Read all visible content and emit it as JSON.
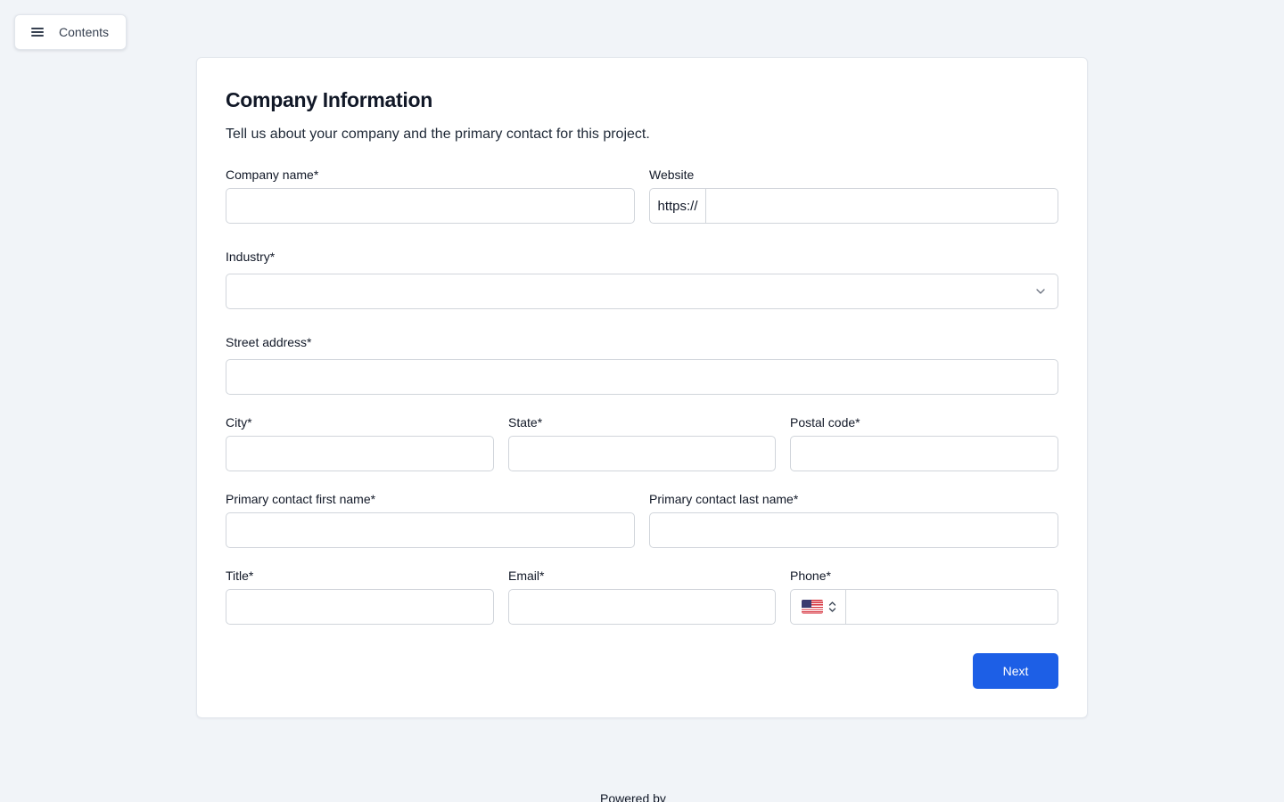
{
  "nav": {
    "contents_label": "Contents"
  },
  "form": {
    "title": "Company Information",
    "subtitle": "Tell us about your company and the primary contact for this project.",
    "fields": {
      "company_name": {
        "label": "Company name*",
        "value": ""
      },
      "website": {
        "label": "Website",
        "prefix": "https://",
        "value": ""
      },
      "industry": {
        "label": "Industry*",
        "value": ""
      },
      "street_address": {
        "label": "Street address*",
        "value": ""
      },
      "city": {
        "label": "City*",
        "value": ""
      },
      "state": {
        "label": "State*",
        "value": ""
      },
      "postal_code": {
        "label": "Postal code*",
        "value": ""
      },
      "first_name": {
        "label": "Primary contact first name*",
        "value": ""
      },
      "last_name": {
        "label": "Primary contact last name*",
        "value": ""
      },
      "title": {
        "label": "Title*",
        "value": ""
      },
      "email": {
        "label": "Email*",
        "value": ""
      },
      "phone": {
        "label": "Phone*",
        "country_icon": "us-flag-icon",
        "value": ""
      }
    },
    "next_label": "Next"
  },
  "footer": {
    "powered_by": "Powered by"
  },
  "colors": {
    "accent": "#1d5fe6",
    "page_background": "#f1f4f8",
    "card_background": "#ffffff",
    "border": "#d1d5db"
  }
}
